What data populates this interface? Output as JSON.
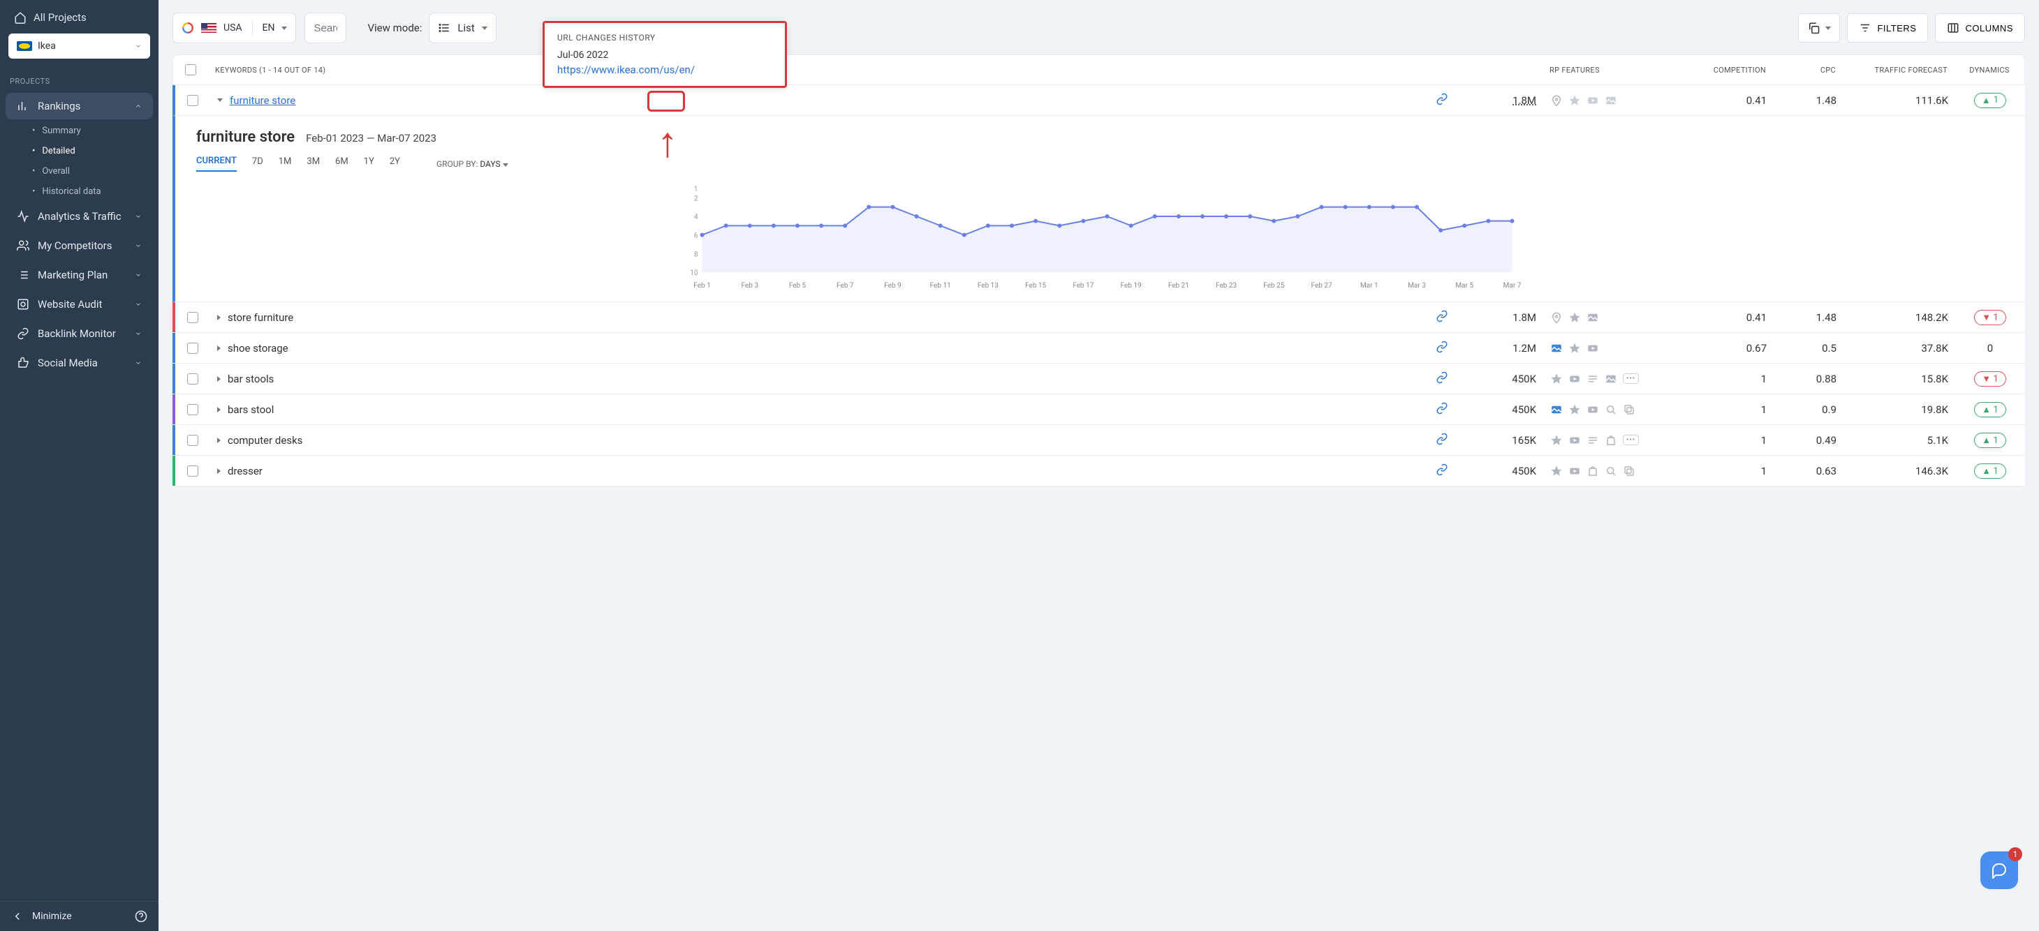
{
  "sidebar": {
    "all_projects": "All Projects",
    "project_name": "Ikea",
    "section_label": "PROJECTS",
    "rankings": {
      "label": "Rankings",
      "children": [
        {
          "label": "Summary"
        },
        {
          "label": "Detailed"
        },
        {
          "label": "Overall"
        },
        {
          "label": "Historical data"
        }
      ]
    },
    "nav": [
      {
        "label": "Analytics & Traffic"
      },
      {
        "label": "My Competitors"
      },
      {
        "label": "Marketing Plan"
      },
      {
        "label": "Website Audit"
      },
      {
        "label": "Backlink Monitor"
      },
      {
        "label": "Social Media"
      }
    ],
    "minimize": "Minimize"
  },
  "toolbar": {
    "country": "USA",
    "lang": "EN",
    "search_placeholder": "Search",
    "viewmode_label": "View mode:",
    "viewmode_value": "List",
    "filters": "FILTERS",
    "columns": "COLUMNS"
  },
  "popover": {
    "title": "URL CHANGES HISTORY",
    "date": "Jul-06 2022",
    "url": "https://www.ikea.com/us/en/"
  },
  "table": {
    "header": {
      "keywords": "KEYWORDS (1 - 14 OUT OF 14)",
      "serp": "RP FEATURES",
      "comp": "COMPETITION",
      "cpc": "CPC",
      "traffic": "TRAFFIC FORECAST",
      "dyn": "DYNAMICS"
    },
    "hero": {
      "keyword": "furniture store",
      "sv": "1.8M",
      "comp": "0.41",
      "cpc": "1.48",
      "traffic": "111.6K",
      "dyn": "1",
      "dyn_dir": "up"
    },
    "rows": [
      {
        "bar": "red",
        "keyword": "store furniture",
        "sv": "1.8M",
        "comp": "0.41",
        "cpc": "1.48",
        "traffic": "148.2K",
        "dyn": "1",
        "dyn_dir": "down",
        "serp": [
          "pin-off",
          "star-off",
          "img-off"
        ]
      },
      {
        "bar": "blue",
        "keyword": "shoe storage",
        "sv": "1.2M",
        "comp": "0.67",
        "cpc": "0.5",
        "traffic": "37.8K",
        "dyn": "0",
        "dyn_dir": "none",
        "serp": [
          "img-on",
          "star-off",
          "video-off"
        ]
      },
      {
        "bar": "blue",
        "keyword": "bar stools",
        "sv": "450K",
        "comp": "1",
        "cpc": "0.88",
        "traffic": "15.8K",
        "dyn": "1",
        "dyn_dir": "down",
        "serp": [
          "star-off",
          "video-off",
          "lines-off",
          "img-off",
          "more"
        ]
      },
      {
        "bar": "purple",
        "keyword": "bars stool",
        "sv": "450K",
        "comp": "1",
        "cpc": "0.9",
        "traffic": "19.8K",
        "dyn": "1",
        "dyn_dir": "up",
        "serp": [
          "img-on",
          "star-off",
          "video-off",
          "search-off",
          "copy-off"
        ]
      },
      {
        "bar": "blue",
        "keyword": "computer desks",
        "sv": "165K",
        "comp": "1",
        "cpc": "0.49",
        "traffic": "5.1K",
        "dyn": "1",
        "dyn_dir": "up",
        "serp": [
          "star-off",
          "video-off",
          "lines-off",
          "bag-off",
          "more"
        ]
      },
      {
        "bar": "green",
        "keyword": "dresser",
        "sv": "450K",
        "comp": "1",
        "cpc": "0.63",
        "traffic": "146.3K",
        "dyn": "1",
        "dyn_dir": "up",
        "serp": [
          "star-off",
          "video-off",
          "bag-off",
          "search-off",
          "copy-off"
        ]
      }
    ]
  },
  "expand": {
    "title": "furniture store",
    "range": "Feb-01 2023 — Mar-07 2023",
    "tabs": [
      "CURRENT",
      "7D",
      "1M",
      "3M",
      "6M",
      "1Y",
      "2Y"
    ],
    "groupby_label": "GROUP BY:",
    "groupby_value": "DAYS"
  },
  "chat": {
    "badge": "1"
  },
  "chart_data": {
    "type": "line",
    "title": "",
    "xlabel": "",
    "ylabel": "",
    "ylim": [
      1,
      10
    ],
    "y_ticks": [
      1,
      2,
      4,
      6,
      8,
      10
    ],
    "categories": [
      "Feb 1",
      "Feb 2",
      "Feb 3",
      "Feb 4",
      "Feb 5",
      "Feb 6",
      "Feb 7",
      "Feb 8",
      "Feb 9",
      "Feb 10",
      "Feb 11",
      "Feb 12",
      "Feb 13",
      "Feb 14",
      "Feb 15",
      "Feb 16",
      "Feb 17",
      "Feb 18",
      "Feb 19",
      "Feb 20",
      "Feb 21",
      "Feb 22",
      "Feb 23",
      "Feb 24",
      "Feb 25",
      "Feb 26",
      "Feb 27",
      "Feb 28",
      "Mar 1",
      "Mar 2",
      "Mar 3",
      "Mar 4",
      "Mar 5",
      "Mar 6",
      "Mar 7"
    ],
    "x_tick_labels": [
      "Feb 1",
      "Feb 3",
      "Feb 5",
      "Feb 7",
      "Feb 9",
      "Feb 11",
      "Feb 13",
      "Feb 15",
      "Feb 17",
      "Feb 19",
      "Feb 21",
      "Feb 23",
      "Feb 25",
      "Feb 27",
      "Mar 1",
      "Mar 3",
      "Mar 5",
      "Mar 7"
    ],
    "values": [
      6,
      5,
      5,
      5,
      5,
      5,
      5,
      3,
      3,
      4,
      5,
      6,
      5,
      5,
      4.5,
      5,
      4.5,
      4,
      5,
      4,
      4,
      4,
      4,
      4,
      4.5,
      4,
      3,
      3,
      3,
      3,
      3,
      5.5,
      5,
      4.5,
      4.5
    ]
  }
}
